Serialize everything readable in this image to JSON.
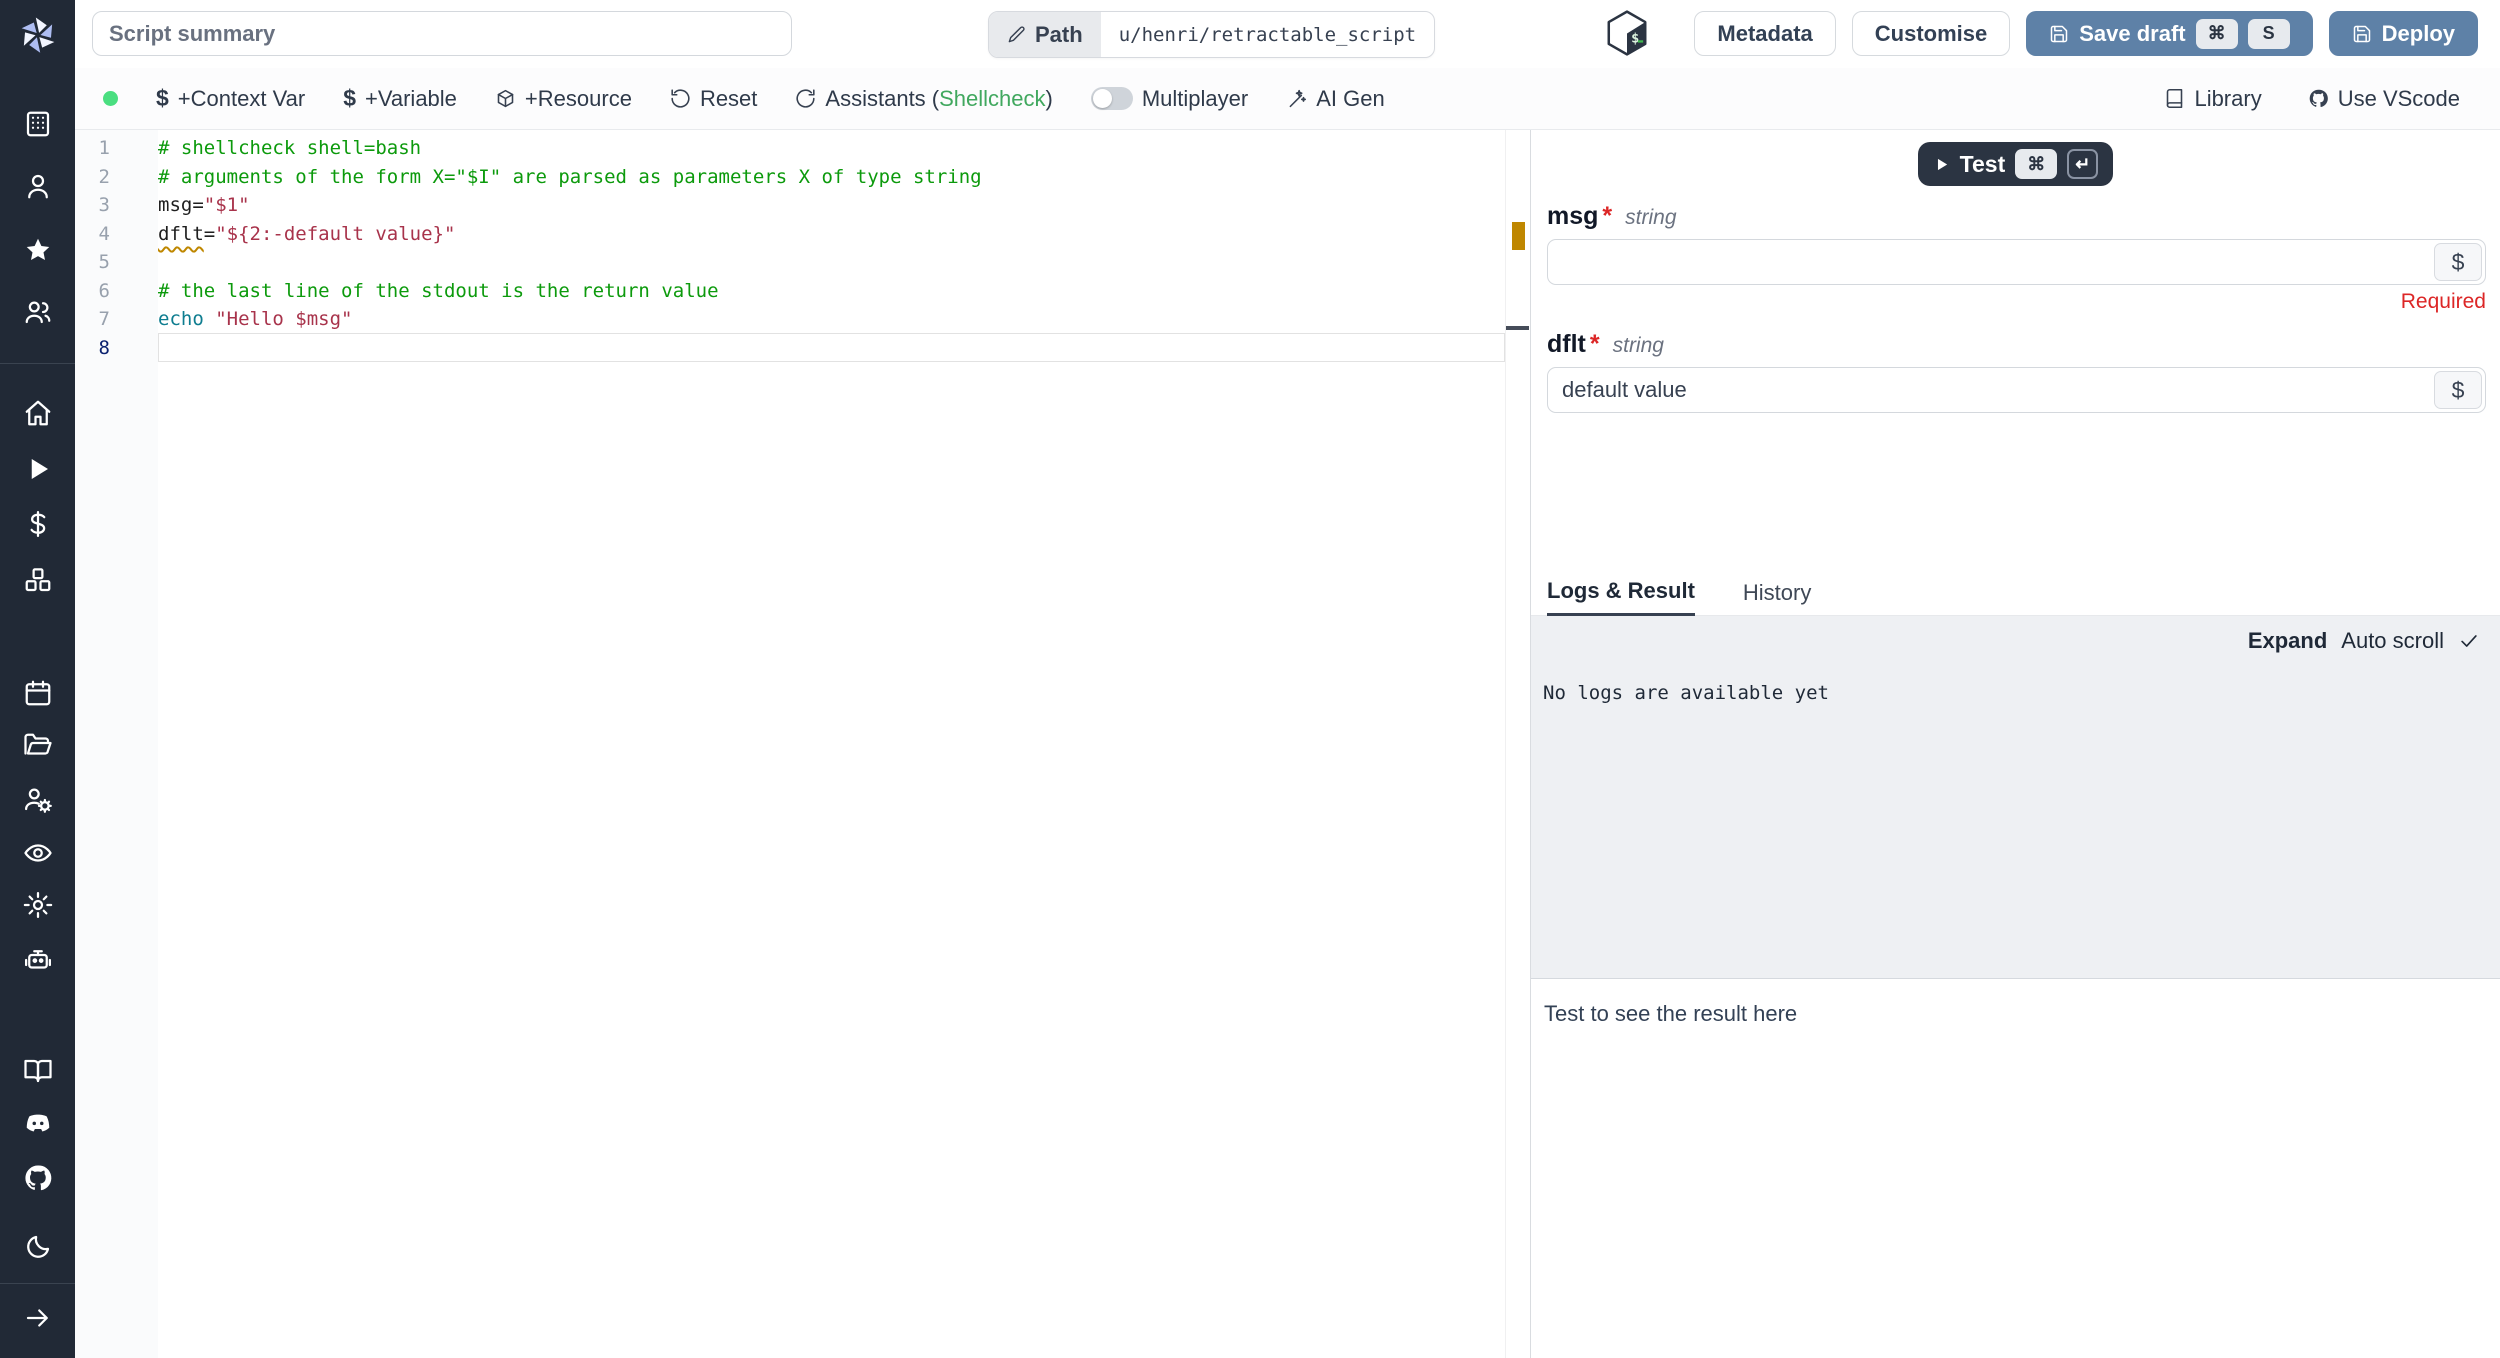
{
  "colors": {
    "sidebar-bg": "#212936",
    "accent": "#5e81a7",
    "dark-btn": "#2b3442",
    "green-dot": "#4ade80",
    "shellcheck-green": "#41a85f",
    "required-red": "#dc2626",
    "warn-amber": "#bf8700",
    "code-comment": "#0c9a0c",
    "code-string": "#a8334b",
    "code-builtin": "#0e7d90",
    "code-plain": "#1f1f1f",
    "linenum": "#98a1ad",
    "linenum-active": "#0b216f"
  },
  "topbar": {
    "summary_placeholder": "Script summary",
    "path_label": "Path",
    "path_value": "u/henri/retractable_script",
    "metadata_label": "Metadata",
    "customise_label": "Customise",
    "save_draft_label": "Save draft",
    "save_kbd_1": "⌘",
    "save_kbd_2": "S",
    "deploy_label": "Deploy"
  },
  "toolbar": {
    "dollar": "$",
    "context_var_label": "+Context Var",
    "variable_label": "+Variable",
    "resource_label": "+Resource",
    "reset_label": "Reset",
    "assistants_label": "Assistants (",
    "assistants_link": "Shellcheck",
    "assistants_close": ")",
    "multiplayer_label": "Multiplayer",
    "ai_gen_label": "AI Gen",
    "library_label": "Library",
    "vscode_label": "Use VScode"
  },
  "editor": {
    "lines": [
      {
        "num": "1",
        "tokens": [
          {
            "text": "# shellcheck shell=bash",
            "type": "comment"
          }
        ]
      },
      {
        "num": "2",
        "tokens": [
          {
            "text": "# arguments of the form X=\"$I\" are parsed as parameters X of type string",
            "type": "comment"
          }
        ]
      },
      {
        "num": "3",
        "tokens": [
          {
            "text": "msg=",
            "type": "plain"
          },
          {
            "text": "\"$1\"",
            "type": "string"
          }
        ]
      },
      {
        "num": "4",
        "tokens": [
          {
            "text": "dflt",
            "type": "plain warn"
          },
          {
            "text": "=",
            "type": "plain"
          },
          {
            "text": "\"${2:-default value}\"",
            "type": "string"
          }
        ]
      },
      {
        "num": "5",
        "tokens": []
      },
      {
        "num": "6",
        "tokens": [
          {
            "text": "# the last line of the stdout is the return value",
            "type": "comment"
          }
        ]
      },
      {
        "num": "7",
        "tokens": [
          {
            "text": "echo",
            "type": "builtin"
          },
          {
            "text": " ",
            "type": "plain"
          },
          {
            "text": "\"Hello $msg\"",
            "type": "string"
          }
        ]
      },
      {
        "num": "8",
        "tokens": [],
        "current": true
      }
    ]
  },
  "runform": {
    "test_label": "Test",
    "test_kbd_1": "⌘",
    "test_kbd_2": "↵",
    "dollar_button": "$",
    "fields": [
      {
        "label": "msg",
        "star": "*",
        "type": "string",
        "value": "",
        "note": "Required"
      },
      {
        "label": "dflt",
        "star": "*",
        "type": "string",
        "value": "default value",
        "note": ""
      }
    ]
  },
  "panel_tabs": {
    "logs": "Logs & Result",
    "history": "History"
  },
  "logs": {
    "expand_label": "Expand",
    "autoscroll_label": "Auto scroll",
    "empty_message": "No logs are available yet"
  },
  "result": {
    "placeholder": "Test to see the result here"
  },
  "sidebar": {
    "items": [
      "building",
      "user",
      "star",
      "users",
      "home",
      "play",
      "dollar",
      "boxes",
      "calendar",
      "folder-open",
      "users-cog",
      "eye",
      "gear",
      "bot",
      "book-open",
      "discord",
      "github",
      "moon",
      "arrow-right"
    ]
  }
}
